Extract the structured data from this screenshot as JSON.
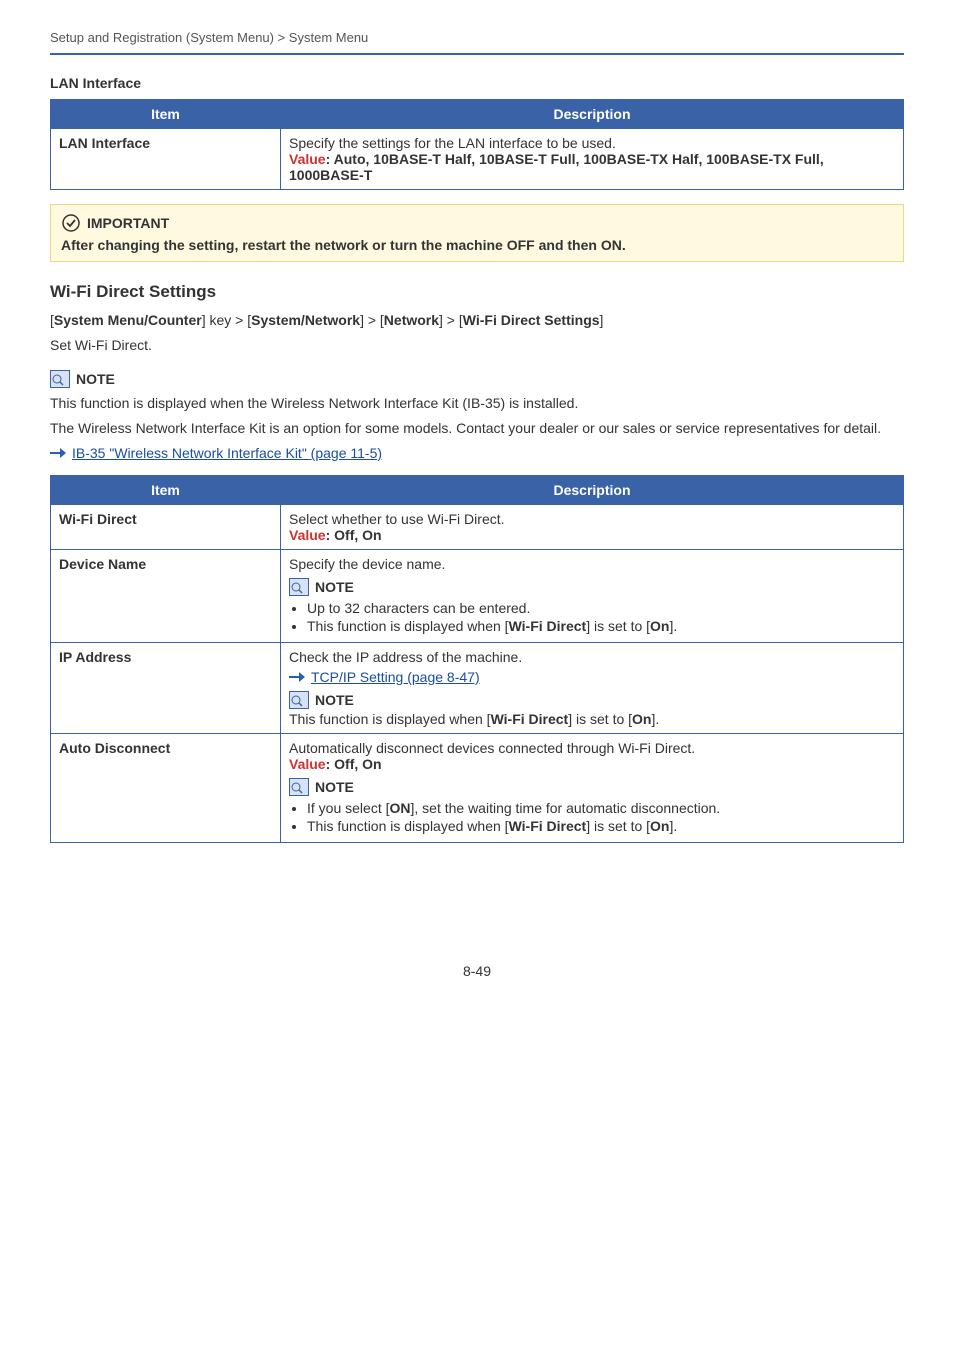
{
  "breadcrumb": "Setup and Registration (System Menu) > System Menu",
  "lan_section": {
    "heading": "LAN Interface",
    "th_item": "Item",
    "th_desc": "Description",
    "row_item": "LAN Interface",
    "row_desc_line1": "Specify the settings for the LAN interface to be used.",
    "row_value_label": "Value",
    "row_value_text": ": Auto, 10BASE-T Half, 10BASE-T Full, 100BASE-TX Half, 100BASE-TX Full, 1000BASE-T"
  },
  "important": {
    "label": "IMPORTANT",
    "text": "After changing the setting, restart the network or turn the machine OFF and then ON."
  },
  "wifi_section": {
    "heading": "Wi-Fi Direct Settings",
    "navpath_parts": {
      "p1": "System Menu/Counter",
      "p2": "System/Network",
      "p3": "Network",
      "p4": "Wi-Fi Direct Settings",
      "sep_key": "] key > [",
      "sep_gt": "] > ["
    },
    "set_line": "Set Wi-Fi Direct.",
    "note_label": "NOTE",
    "note_p1": "This function is displayed when the Wireless Network Interface Kit (IB-35) is installed.",
    "note_p2": "The Wireless Network Interface Kit is an option for some models. Contact your dealer or our sales or service representatives for detail.",
    "note_link": "IB-35 \"Wireless Network Interface Kit\" (page 11-5)",
    "th_item": "Item",
    "th_desc": "Description",
    "rows": {
      "r1": {
        "item": "Wi-Fi Direct",
        "line1": "Select whether to use Wi-Fi Direct.",
        "value_label": "Value",
        "value_text": ": Off, On"
      },
      "r2": {
        "item": "Device Name",
        "line1": "Specify the device name.",
        "note_label": "NOTE",
        "li1": "Up to 32 characters can be entered.",
        "li2_a": "This function is displayed when [",
        "li2_b": "Wi-Fi Direct",
        "li2_c": "] is set to [",
        "li2_d": "On",
        "li2_e": "]."
      },
      "r3": {
        "item": "IP Address",
        "line1": "Check the IP address of the machine.",
        "link": "TCP/IP Setting (page 8-47)",
        "note_label": "NOTE",
        "note_a": "This function is displayed when [",
        "note_b": "Wi-Fi Direct",
        "note_c": "] is set to [",
        "note_d": "On",
        "note_e": "]."
      },
      "r4": {
        "item": "Auto Disconnect",
        "line1": "Automatically disconnect devices connected through Wi-Fi Direct.",
        "value_label": "Value",
        "value_text": ": Off, On",
        "note_label": "NOTE",
        "li1_a": "If you select [",
        "li1_b": "ON",
        "li1_c": "], set the waiting time for automatic disconnection.",
        "li2_a": "This function is displayed when [",
        "li2_b": "Wi-Fi Direct",
        "li2_c": "] is set to [",
        "li2_d": "On",
        "li2_e": "]."
      }
    }
  },
  "pagenum": "8-49"
}
